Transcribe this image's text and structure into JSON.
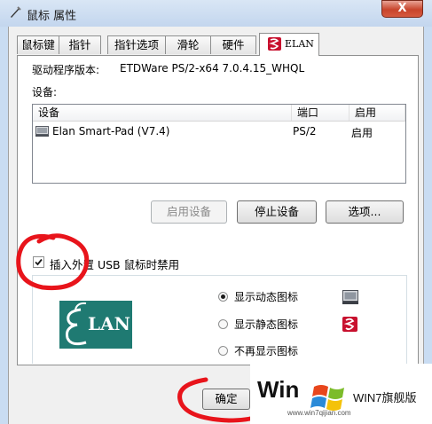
{
  "window": {
    "title": "鼠标 属性",
    "close_glyph": "X"
  },
  "tabs": [
    {
      "label": "鼠标键"
    },
    {
      "label": "指针"
    },
    {
      "label": "指针选项"
    },
    {
      "label": "滑轮"
    },
    {
      "label": "硬件"
    },
    {
      "label": "ELAN",
      "active": true
    }
  ],
  "driver": {
    "label": "驱动程序版本:",
    "version": "ETDWare PS/2-x64 7.0.4.15_WHQL"
  },
  "devices_label": "设备:",
  "device_list": {
    "columns": [
      "设备",
      "端口",
      "启用"
    ],
    "rows": [
      {
        "device": "Elan Smart-Pad  (V7.4)",
        "port": "PS/2",
        "enabled": "启用"
      }
    ]
  },
  "buttons": {
    "enable_device": "启用设备",
    "stop_device": "停止设备",
    "options": "选项..."
  },
  "usb_disable": {
    "label": "插入外置 USB 鼠标时禁用",
    "checked": true
  },
  "logo_text": "LAN",
  "icon_display": {
    "options": [
      {
        "label": "显示动态图标",
        "selected": true
      },
      {
        "label": "显示静态图标",
        "selected": false
      },
      {
        "label": "不再显示图标",
        "selected": false
      }
    ]
  },
  "ok_button": "确定",
  "watermark": {
    "left_text": "Win",
    "brand": "WIN7旗舰版",
    "url": "www.win7qijian.com"
  },
  "colors": {
    "annotation_red": "#e8141b",
    "elan_brand_red": "#c8102e",
    "elan_logo_teal": "#1f7a72"
  }
}
